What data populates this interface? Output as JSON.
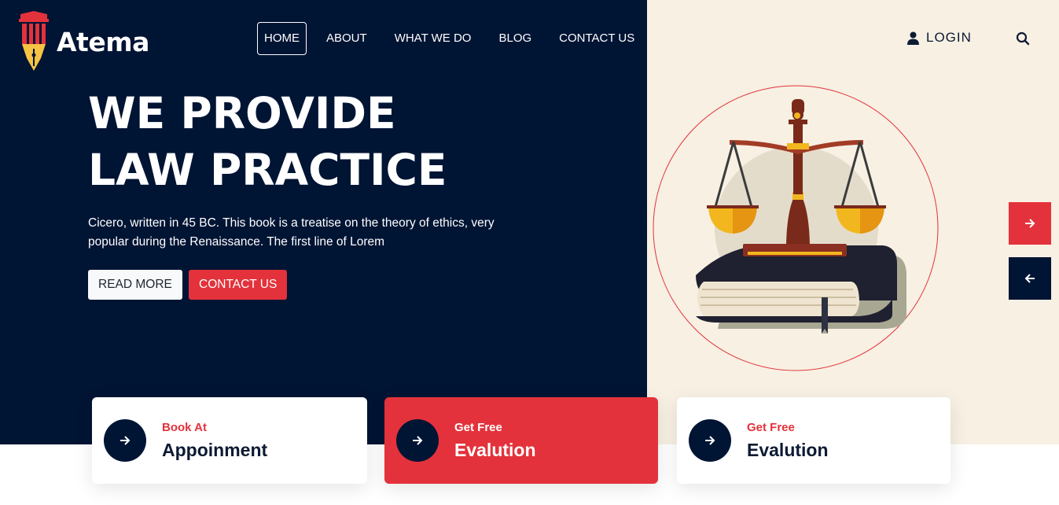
{
  "brand": {
    "name": "Atema",
    "logo_icon": "pen-pillar-logo"
  },
  "nav": {
    "items": [
      {
        "label": "HOME",
        "active": true
      },
      {
        "label": "ABOUT"
      },
      {
        "label": "WHAT WE DO"
      },
      {
        "label": "BLOG"
      },
      {
        "label": "CONTACT US"
      }
    ]
  },
  "header": {
    "login_label": "LOGIN",
    "login_icon": "user-icon",
    "search_icon": "search-icon"
  },
  "hero": {
    "title_line1": "WE PROVIDE",
    "title_line2": "LAW PRACTICE",
    "description": "Cicero, written in 45 BC. This book is a treatise on the theory of ethics, very popular during the Renaissance. The first line of Lorem",
    "read_more_label": "READ MORE",
    "contact_label": "CONTACT US",
    "illustration": "scales-of-justice-on-book"
  },
  "slider": {
    "next_icon": "arrow-right-icon",
    "prev_icon": "arrow-left-icon"
  },
  "cards": [
    {
      "small": "Book At",
      "big": "Appoinment"
    },
    {
      "small": "Get Free",
      "big": "Evalution"
    },
    {
      "small": "Get Free",
      "big": "Evalution"
    }
  ],
  "colors": {
    "navy": "#001434",
    "red": "#e3323b",
    "cream": "#f7f0e3",
    "white": "#ffffff"
  }
}
